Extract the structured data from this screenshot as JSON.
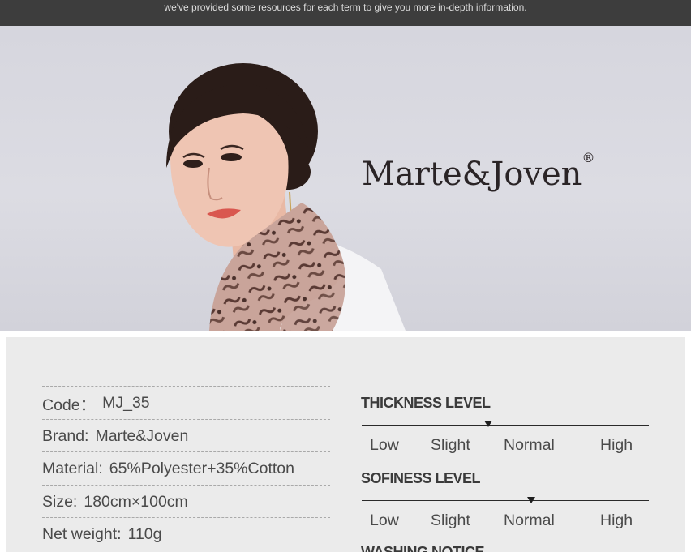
{
  "header": {
    "notice_text": "we've provided some resources for each term to give you more in-depth information."
  },
  "hero": {
    "image_subject": "model wearing printed scarf",
    "brand_logo_text": "Marte&Joven",
    "registered_mark": "®"
  },
  "specs": [
    {
      "label": "Code：",
      "value": "MJ_35"
    },
    {
      "label": "Brand:",
      "value": "Marte&Joven"
    },
    {
      "label": "Material:",
      "value": "65%Polyester+35%Cotton"
    },
    {
      "label": "Size:",
      "value": "180cm×100cm"
    },
    {
      "label": "Net weight:",
      "value": "110g"
    }
  ],
  "thickness": {
    "title": "THICKNESS LEVEL",
    "labels": [
      "Low",
      "Slight",
      "Normal",
      "High"
    ],
    "selected": "Normal",
    "level_fraction": 0.44
  },
  "softness": {
    "title": "SOFINESS LEVEL",
    "labels": [
      "Low",
      "Slight",
      "Normal",
      "High"
    ],
    "selected": "Normal",
    "level_fraction": 0.59
  },
  "washing": {
    "title": "WASHING NOTICE"
  },
  "colors": {
    "top_bar": "#3d3d3d",
    "panel_bg": "#ebebeb",
    "scarf": "#c9a49a"
  }
}
